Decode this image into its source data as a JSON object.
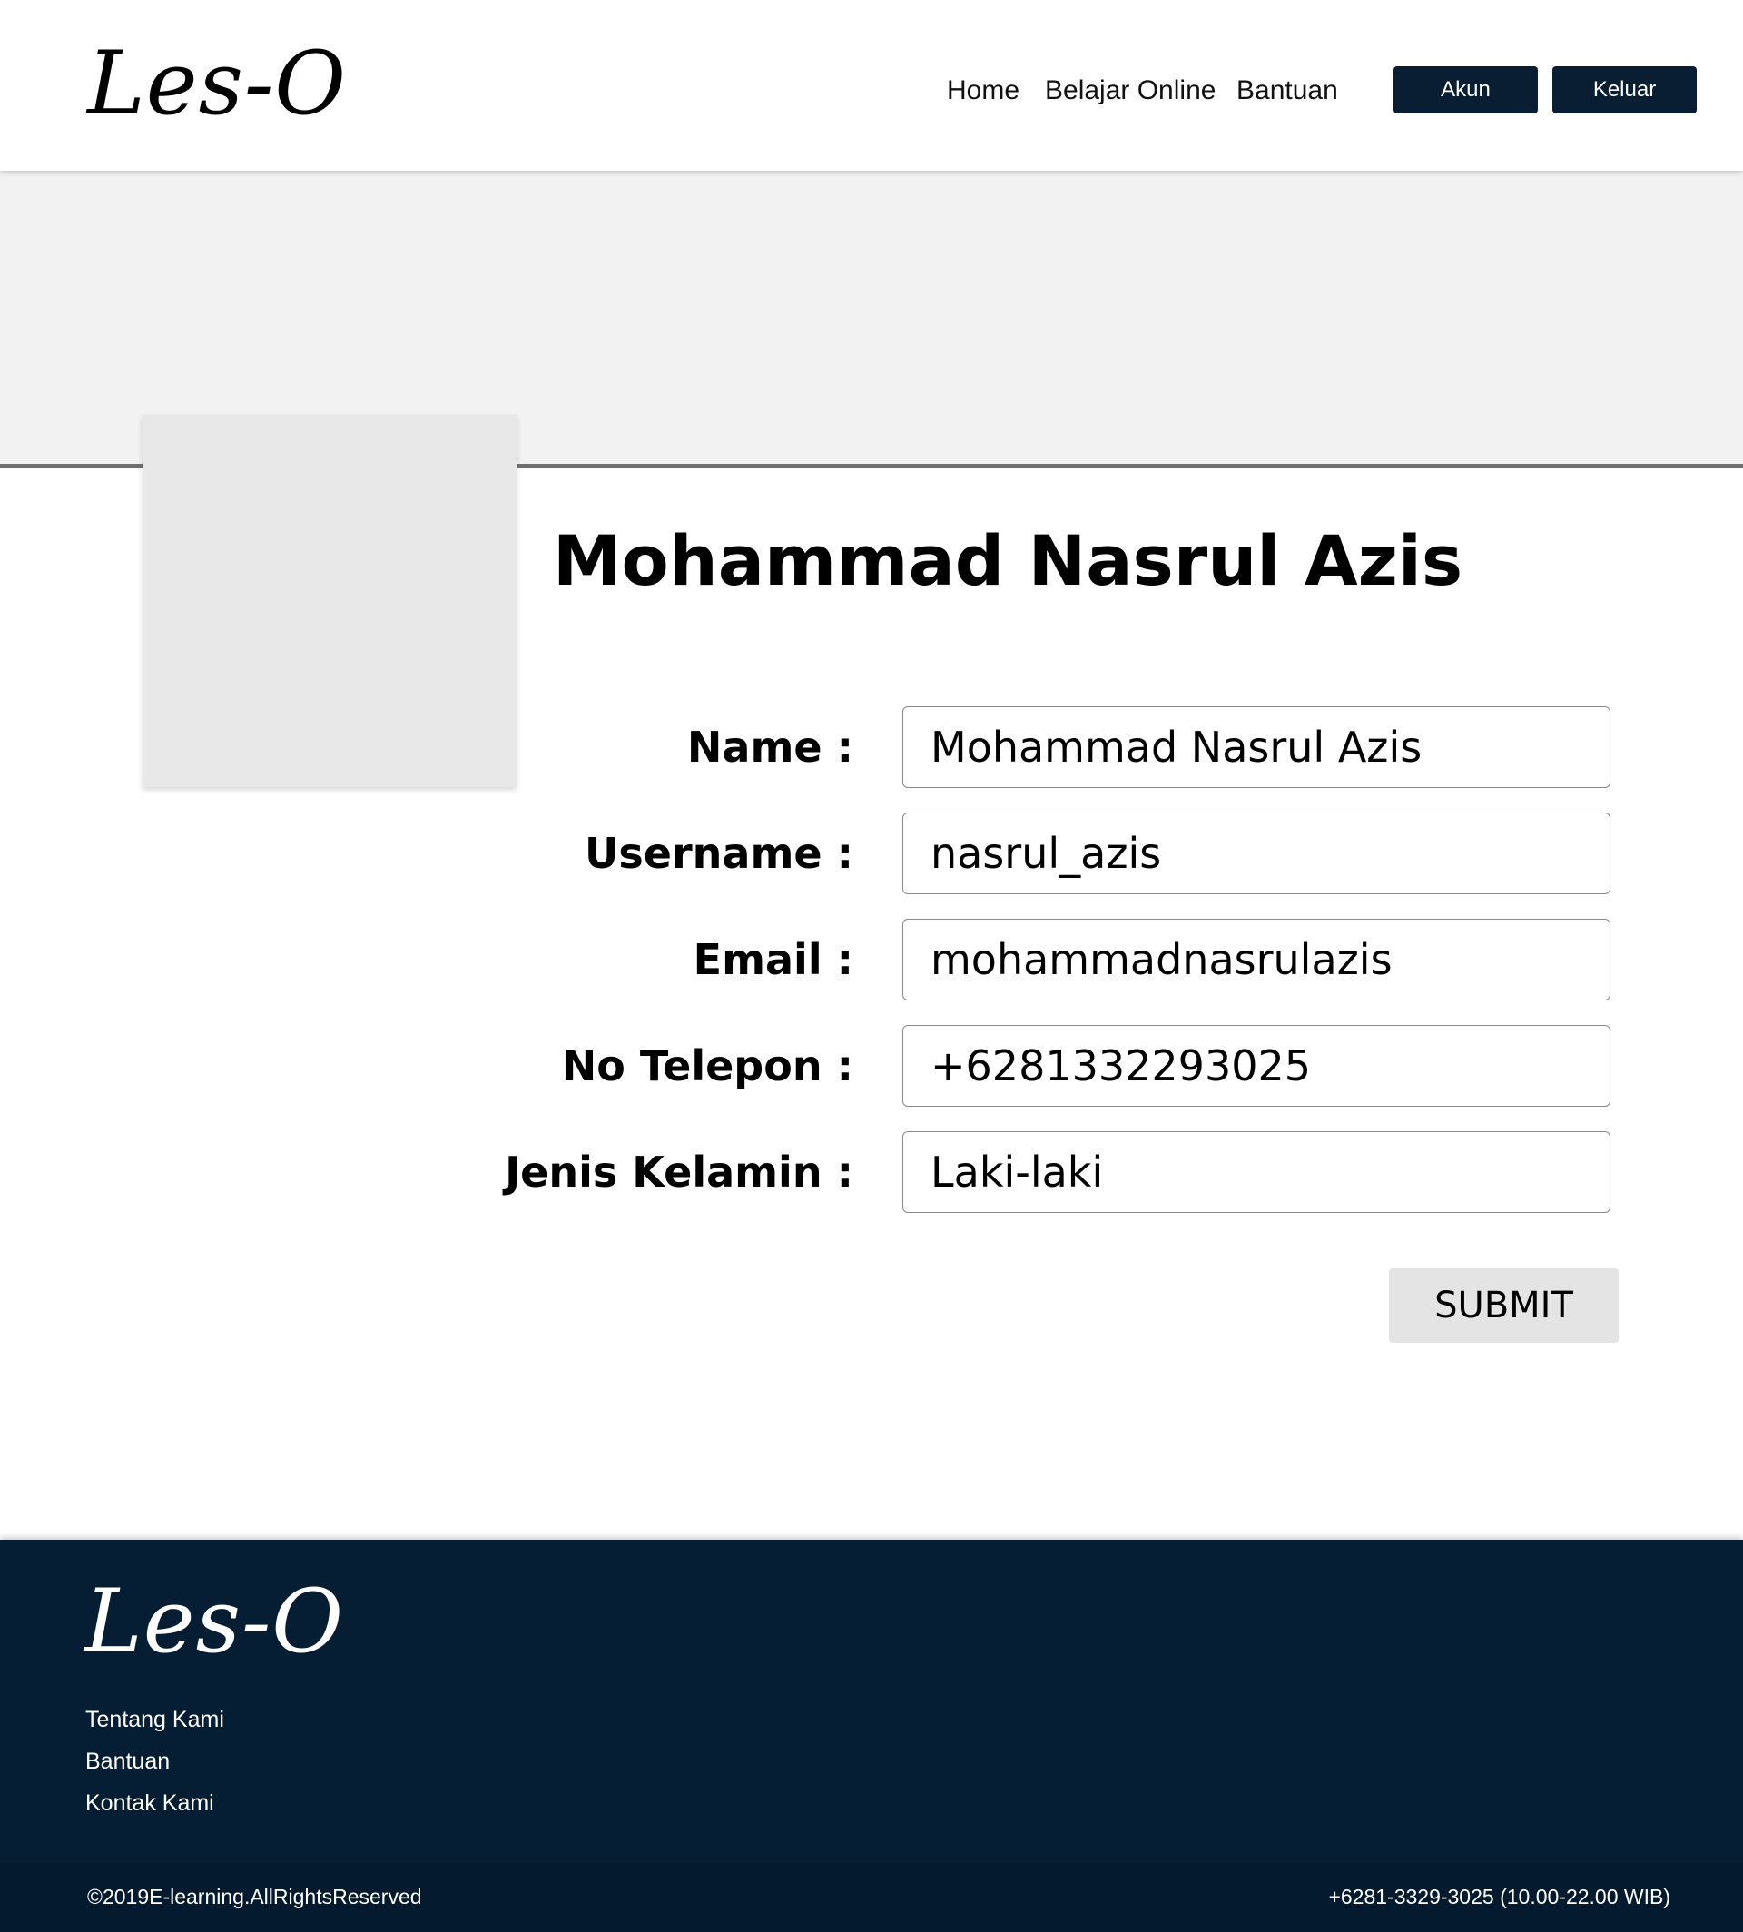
{
  "header": {
    "logo": "Les-O",
    "nav": {
      "home": "Home",
      "belajar_online": "Belajar Online",
      "bantuan": "Bantuan"
    },
    "buttons": {
      "akun": "Akun",
      "keluar": "Keluar"
    }
  },
  "profile": {
    "display_name": "Mohammad Nasrul Azis"
  },
  "form": {
    "name": {
      "label": "Name :",
      "value": "Mohammad Nasrul Azis"
    },
    "username": {
      "label": "Username :",
      "value": "nasrul_azis"
    },
    "email": {
      "label": "Email :",
      "value": "mohammadnasrulazis"
    },
    "phone": {
      "label": "No Telepon :",
      "value": "+6281332293025"
    },
    "gender": {
      "label": "Jenis Kelamin :",
      "value": "Laki-laki"
    },
    "submit_label": "SUBMIT"
  },
  "footer": {
    "logo": "Les-O",
    "links": [
      "Tentang Kami",
      "Bantuan",
      "Kontak Kami"
    ],
    "copyright": "©2019E-learning.AllRightsReserved",
    "contact": "+6281-3329-3025 (10.00-22.00 WIB)"
  },
  "colors": {
    "navy": "#091d33",
    "footer_bg": "#061e34",
    "banner_bg": "#f2f2f2",
    "avatar_placeholder": "#e8e8e8",
    "submit_bg": "#e4e4e4"
  }
}
